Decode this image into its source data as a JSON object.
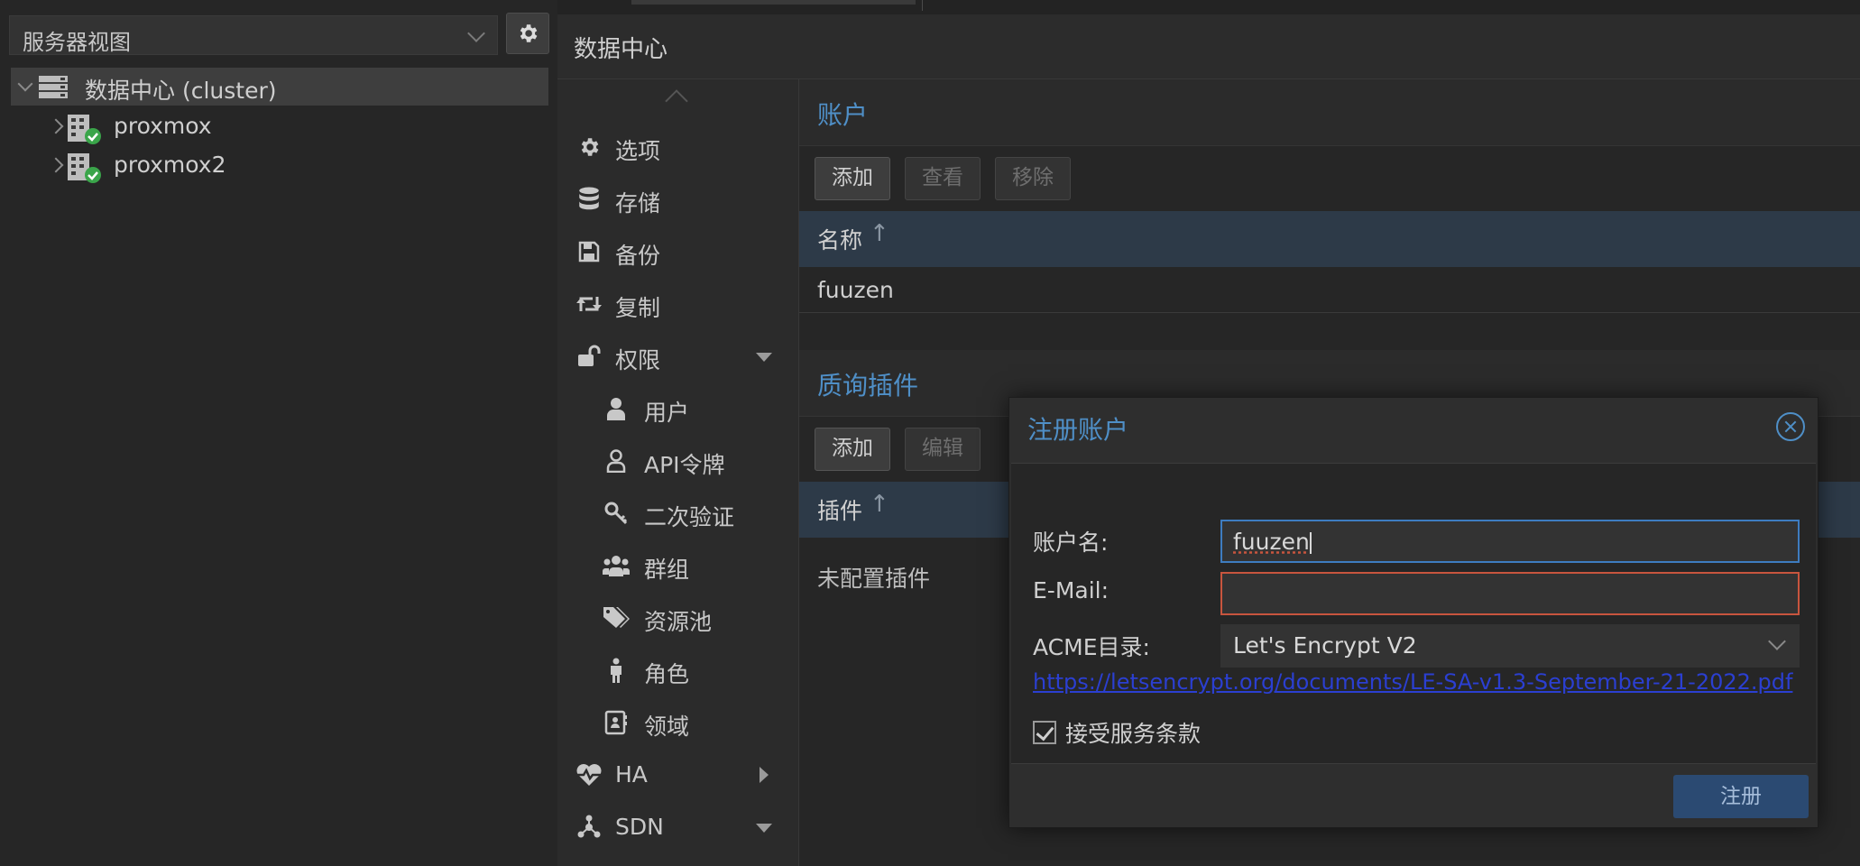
{
  "tree": {
    "view_select": "服务器视图",
    "nodes": [
      {
        "label": "数据中心 (cluster)"
      },
      {
        "label": "proxmox"
      },
      {
        "label": "proxmox2"
      }
    ]
  },
  "header": {
    "title": "数据中心"
  },
  "nav": {
    "items": [
      {
        "label": "选项",
        "icon": "gear-icon"
      },
      {
        "label": "存储",
        "icon": "database-icon"
      },
      {
        "label": "备份",
        "icon": "floppy-icon"
      },
      {
        "label": "复制",
        "icon": "retweet-icon"
      },
      {
        "label": "权限",
        "icon": "unlock-icon"
      },
      {
        "label": "用户",
        "icon": "user-icon"
      },
      {
        "label": "API令牌",
        "icon": "user-outline-icon"
      },
      {
        "label": "二次验证",
        "icon": "key-icon"
      },
      {
        "label": "群组",
        "icon": "users-icon"
      },
      {
        "label": "资源池",
        "icon": "tags-icon"
      },
      {
        "label": "角色",
        "icon": "male-icon"
      },
      {
        "label": "领域",
        "icon": "address-book-icon"
      },
      {
        "label": "HA",
        "icon": "heartbeat-icon"
      },
      {
        "label": "SDN",
        "icon": "sdn-icon"
      }
    ]
  },
  "accounts": {
    "title": "账户",
    "buttons": {
      "add": "添加",
      "view": "查看",
      "remove": "移除"
    },
    "column": "名称",
    "sort_arrow": "↑",
    "rows": [
      "fuuzen"
    ]
  },
  "plugins": {
    "title": "质询插件",
    "buttons": {
      "add": "添加",
      "edit": "编辑"
    },
    "column": "插件",
    "sort_arrow": "↑",
    "empty": "未配置插件"
  },
  "dialog": {
    "title": "注册账户",
    "account_name_label": "账户名:",
    "account_name_value": "fuuzen",
    "email_label": "E-Mail:",
    "email_value": "",
    "acme_label": "ACME目录:",
    "acme_value": "Let's Encrypt V2",
    "tos_link": "https://letsencrypt.org/documents/LE-SA-v1.3-September-21-2022.pdf",
    "tos_label": "接受服务条款",
    "register": "注册"
  },
  "colors": {
    "accent": "#4f8fc7",
    "error_border": "#c8553e",
    "grid_header": "#2d3a48",
    "link": "#2b3fd1",
    "status_ok": "#3aa54a"
  }
}
